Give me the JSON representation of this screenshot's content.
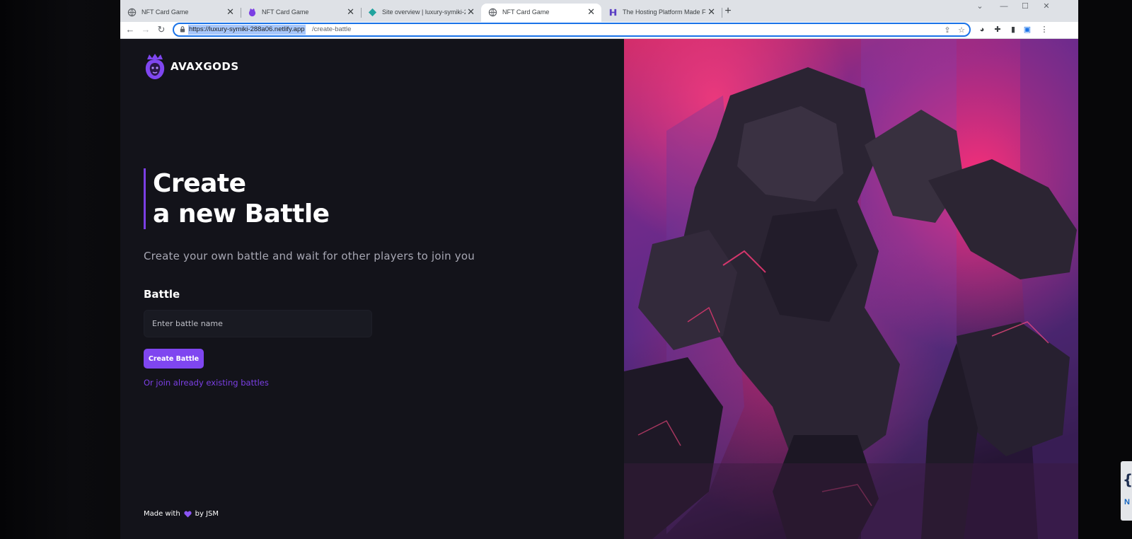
{
  "browser": {
    "tabs": [
      {
        "title": "NFT Card Game",
        "active": false,
        "favicon": "globe-icon"
      },
      {
        "title": "NFT Card Game",
        "active": false,
        "favicon": "lion-icon"
      },
      {
        "title": "Site overview | luxury-symiki-288",
        "active": false,
        "favicon": "netlify-diamond-icon"
      },
      {
        "title": "NFT Card Game",
        "active": true,
        "favicon": "globe-icon"
      },
      {
        "title": "The Hosting Platform Made For",
        "active": false,
        "favicon": "hosting-logo-icon"
      }
    ],
    "new_tab_label": "+",
    "close_glyph": "✕",
    "url_highlighted": "https://luxury-symiki-288a06.netlify.app",
    "url_rest": "/create-battle",
    "accent": "#1a73e8"
  },
  "page": {
    "brand": "AVAXGODS",
    "title_line1": "Create",
    "title_line2": "a new Battle",
    "subtitle": "Create your own battle and wait for other players to join you",
    "field_label": "Battle",
    "input_placeholder": "Enter battle name",
    "input_value": "",
    "create_button": "Create Battle",
    "join_link": "Or join already existing battles",
    "footer_prefix": "Made with",
    "footer_suffix": "by JSM",
    "accent": "#7f46f0",
    "background": "#13131a"
  }
}
